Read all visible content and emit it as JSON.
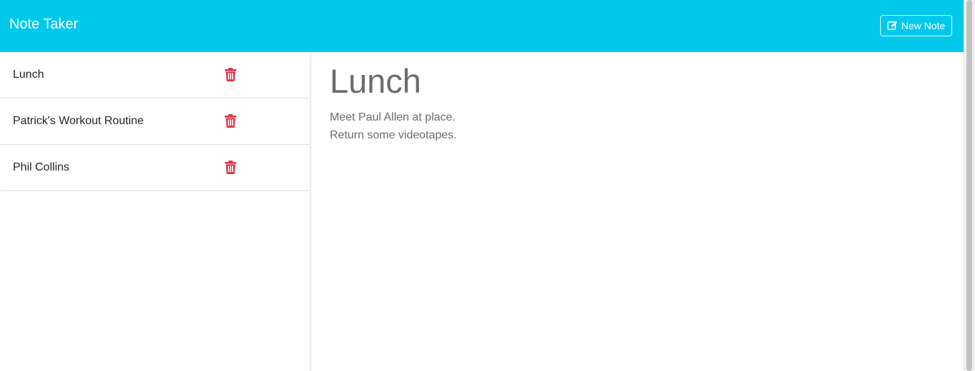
{
  "app": {
    "title": "Note Taker",
    "accent_color": "#00c9ec",
    "delete_color": "#dc3545"
  },
  "toolbar": {
    "new_note_label": "New Note",
    "new_note_icon": "edit-icon"
  },
  "sidebar": {
    "notes": [
      {
        "title": "Lunch",
        "icon": "trash-icon"
      },
      {
        "title": "Patrick's Workout Routine",
        "icon": "trash-icon"
      },
      {
        "title": "Phil Collins",
        "icon": "trash-icon"
      }
    ]
  },
  "editor": {
    "title": "Lunch",
    "body_lines": [
      "Meet Paul Allen at place.",
      "Return some videotapes."
    ]
  }
}
